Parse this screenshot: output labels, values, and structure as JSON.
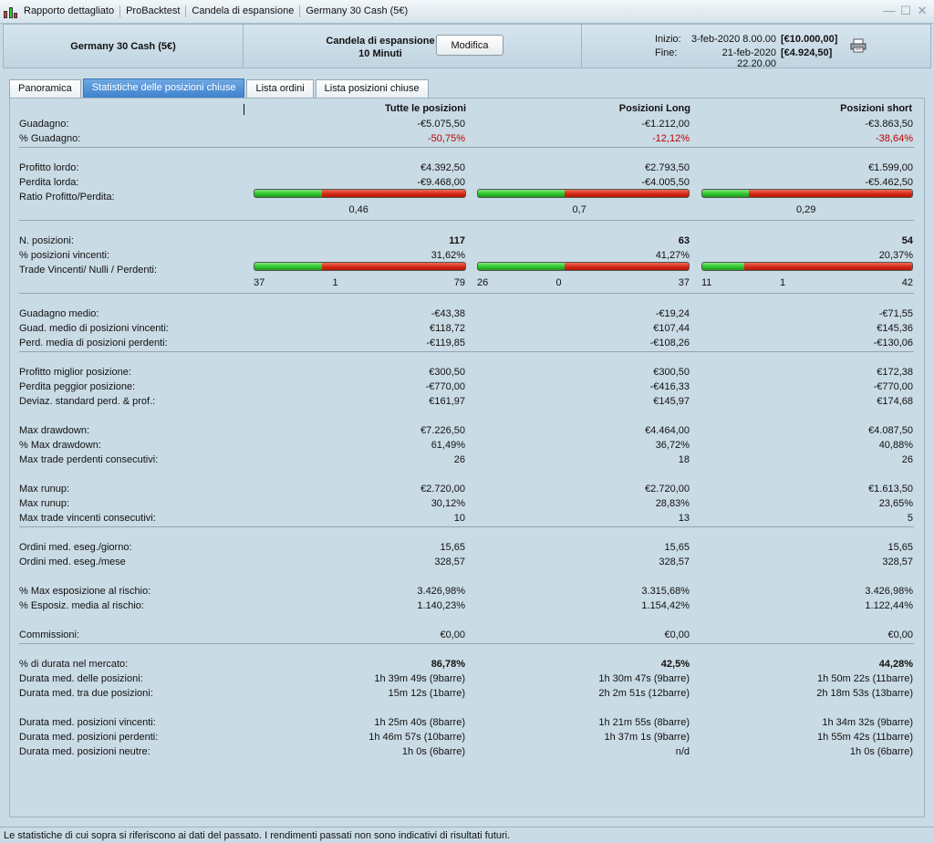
{
  "window": {
    "segments": [
      "Rapporto dettagliato",
      "ProBacktest",
      "Candela di espansione",
      "Germany 30 Cash (5€)"
    ]
  },
  "header": {
    "instrument": "Germany 30 Cash (5€)",
    "strategy_line1": "Candela di espansione",
    "strategy_line2": "10 Minuti",
    "modifica_label": "Modifica",
    "start_label": "Inizio:",
    "start_date": "3-feb-2020 8.00.00",
    "start_capital": "[€10.000,00]",
    "end_label": "Fine:",
    "end_date": "21-feb-2020 22.20.00",
    "end_capital": "[€4.924,50]"
  },
  "tabs": [
    "Panoramica",
    "Statistiche delle posizioni chiuse",
    "Lista ordini",
    "Lista posizioni chiuse"
  ],
  "columns": [
    "Tutte le posizioni",
    "Posizioni Long",
    "Posizioni short"
  ],
  "rows": [
    {
      "label": "Guadagno:",
      "values": [
        "-€5.075,50",
        "-€1.212,00",
        "-€3.863,50"
      ]
    },
    {
      "label": "% Guadagno:",
      "values": [
        "-50,75%",
        "-12,12%",
        "-38,64%"
      ],
      "style": "red"
    },
    {
      "label": "Profitto lordo:",
      "values": [
        "€4.392,50",
        "€2.793,50",
        "€1.599,00"
      ]
    },
    {
      "label": "Perdita lorda:",
      "values": [
        "-€9.468,00",
        "-€4.005,50",
        "-€5.462,50"
      ]
    },
    {
      "label": "Ratio Profitto/Perdita:",
      "type": "ratio",
      "ratios": [
        0.32,
        0.41,
        0.22
      ],
      "labels": [
        "0,46",
        "0,7",
        "0,29"
      ]
    },
    {
      "label": "N. posizioni:",
      "values": [
        "117",
        "63",
        "54"
      ],
      "style": "bold"
    },
    {
      "label": "% posizioni vincenti:",
      "values": [
        "31,62%",
        "41,27%",
        "20,37%"
      ]
    },
    {
      "label": "Trade Vincenti/ Nulli / Perdenti:",
      "type": "wnl",
      "ratios": [
        0.32,
        0.41,
        0.2
      ],
      "counts": [
        [
          "37",
          "1",
          "79"
        ],
        [
          "26",
          "0",
          "37"
        ],
        [
          "11",
          "1",
          "42"
        ]
      ]
    },
    {
      "label": "Guadagno medio:",
      "values": [
        "-€43,38",
        "-€19,24",
        "-€71,55"
      ]
    },
    {
      "label": "Guad. medio di posizioni vincenti:",
      "values": [
        "€118,72",
        "€107,44",
        "€145,36"
      ]
    },
    {
      "label": "Perd. media di posizioni perdenti:",
      "values": [
        "-€119,85",
        "-€108,26",
        "-€130,06"
      ]
    },
    {
      "label": "Profitto miglior posizione:",
      "values": [
        "€300,50",
        "€300,50",
        "€172,38"
      ]
    },
    {
      "label": "Perdita peggior posizione:",
      "values": [
        "-€770,00",
        "-€416,33",
        "-€770,00"
      ]
    },
    {
      "label": "Deviaz. standard perd. & prof.:",
      "values": [
        "€161,97",
        "€145,97",
        "€174,68"
      ]
    },
    {
      "label": "Max drawdown:",
      "values": [
        "€7.226,50",
        "€4.464,00",
        "€4.087,50"
      ]
    },
    {
      "label": "% Max drawdown:",
      "values": [
        "61,49%",
        "36,72%",
        "40,88%"
      ]
    },
    {
      "label": "Max trade perdenti consecutivi:",
      "values": [
        "26",
        "18",
        "26"
      ]
    },
    {
      "label": "Max runup:",
      "values": [
        "€2.720,00",
        "€2.720,00",
        "€1.613,50"
      ]
    },
    {
      "label": "Max runup:",
      "values": [
        "30,12%",
        "28,83%",
        "23,65%"
      ]
    },
    {
      "label": "Max trade vincenti consecutivi:",
      "values": [
        "10",
        "13",
        "5"
      ]
    },
    {
      "label": "Ordini med. eseg./giorno:",
      "values": [
        "15,65",
        "15,65",
        "15,65"
      ]
    },
    {
      "label": "Ordini med. eseg./mese",
      "values": [
        "328,57",
        "328,57",
        "328,57"
      ]
    },
    {
      "label": "% Max esposizione al rischio:",
      "values": [
        "3.426,98%",
        "3.315,68%",
        "3.426,98%"
      ]
    },
    {
      "label": "% Esposiz. media al rischio:",
      "values": [
        "1.140,23%",
        "1.154,42%",
        "1.122,44%"
      ]
    },
    {
      "label": "Commissioni:",
      "values": [
        "€0,00",
        "€0,00",
        "€0,00"
      ]
    },
    {
      "label": "% di durata nel mercato:",
      "values": [
        "86,78%",
        "42,5%",
        "44,28%"
      ],
      "style": "bold"
    },
    {
      "label": "Durata med. delle posizioni:",
      "values": [
        "1h 39m 49s (9barre)",
        "1h 30m 47s (9barre)",
        "1h 50m 22s (11barre)"
      ]
    },
    {
      "label": "Durata med. tra due posizioni:",
      "values": [
        "15m 12s (1barre)",
        "2h 2m 51s (12barre)",
        "2h 18m 53s (13barre)"
      ]
    },
    {
      "label": "Durata med. posizioni vincenti:",
      "values": [
        "1h 25m 40s (8barre)",
        "1h 21m 55s (8barre)",
        "1h 34m 32s (9barre)"
      ]
    },
    {
      "label": "Durata med. posizioni perdenti:",
      "values": [
        "1h 46m 57s (10barre)",
        "1h 37m 1s (9barre)",
        "1h 55m 42s (11barre)"
      ]
    },
    {
      "label": "Durata med. posizioni neutre:",
      "values": [
        "1h 0s (6barre)",
        "n/d",
        "1h 0s (6barre)"
      ]
    }
  ],
  "footer": "Le statistiche di cui sopra si riferiscono ai dati del passato. I rendimenti passati non sono indicativi di risultati futuri.",
  "colors": {
    "positive_bar": "#30c62e",
    "negative_bar": "#d42a17",
    "negative_text": "#c00000",
    "active_tab": "#3f82cf"
  }
}
